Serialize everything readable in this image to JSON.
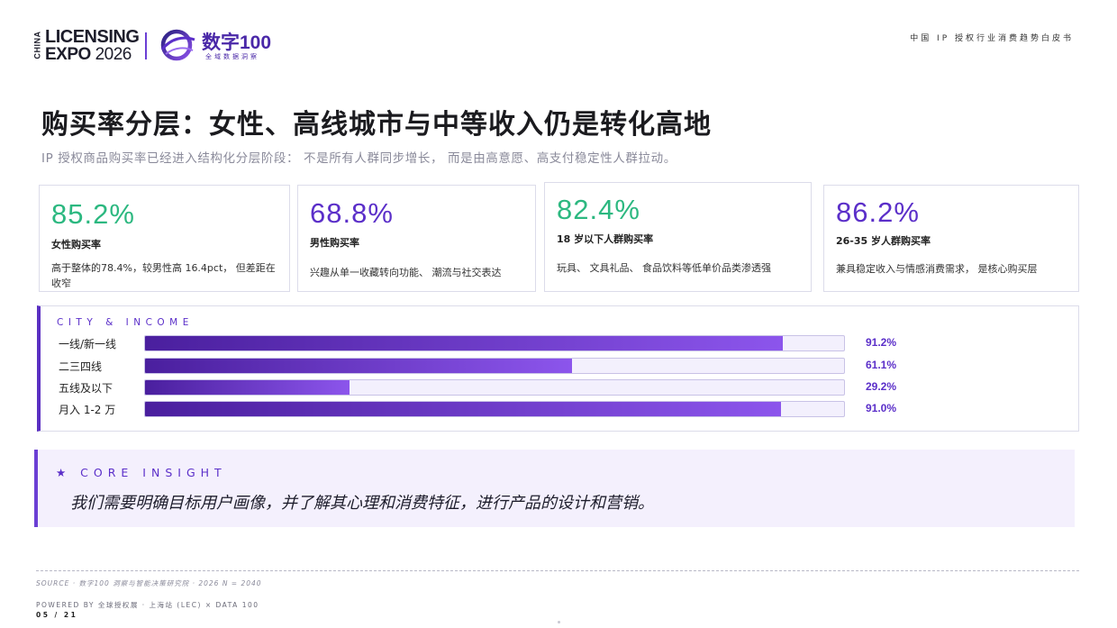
{
  "header": {
    "logo_china": "CHINA",
    "logo_line1": "LICENSING",
    "logo_expo": "EXPO",
    "logo_year": "2026",
    "brand_main": "数字100",
    "brand_sub": "全域数据洞察",
    "doc_title": "中国 IP 授权行业消费趋势白皮书"
  },
  "title": "购买率分层：女性、高线城市与中等收入仍是转化高地",
  "subtitle": "IP 授权商品购买率已经进入结构化分层阶段： 不是所有人群同步增长， 而是由高意愿、高支付稳定性人群拉动。",
  "cards": [
    {
      "value": "85.2%",
      "label": "女性购买率",
      "desc": "高于整体的78.4%，较男性高 16.4pct， 但差距在收窄",
      "color": "#2cb880"
    },
    {
      "value": "68.8%",
      "label": "男性购买率",
      "desc": "兴趣从单一收藏转向功能、 潮流与社交表达",
      "color": "#5b2fc9"
    },
    {
      "value": "82.4%",
      "label": "18 岁以下人群购买率",
      "desc": "玩具、 文具礼品、 食品饮料等低单价品类渗透强",
      "color": "#2cb880"
    },
    {
      "value": "86.2%",
      "label": "26-35 岁人群购买率",
      "desc": "兼具稳定收入与情感消费需求， 是核心购买层",
      "color": "#5b2fc9"
    }
  ],
  "bars": {
    "heading": "CITY & INCOME",
    "items": [
      {
        "label": "一线/新一线",
        "value": 91.2,
        "display": "91.2%"
      },
      {
        "label": "二三四线",
        "value": 61.1,
        "display": "61.1%"
      },
      {
        "label": "五线及以下",
        "value": 29.2,
        "display": "29.2%"
      },
      {
        "label": "月入 1-2 万",
        "value": 91.0,
        "display": "91.0%"
      }
    ]
  },
  "insight": {
    "heading": "★ CORE INSIGHT",
    "text": "我们需要明确目标用户画像，并了解其心理和消费特征，进行产品的设计和营销。"
  },
  "footer": {
    "source": "SOURCE · 数字100 洞察与智能决策研究院 · 2026 N = 2040",
    "powered": "POWERED BY 全球授权展 · 上海站 (LEC) × DATA 100",
    "page": "05 / 21"
  },
  "colors": {
    "accent": "#5b2fc9",
    "green": "#2cb880",
    "insight_bg": "#f4f0fd"
  }
}
